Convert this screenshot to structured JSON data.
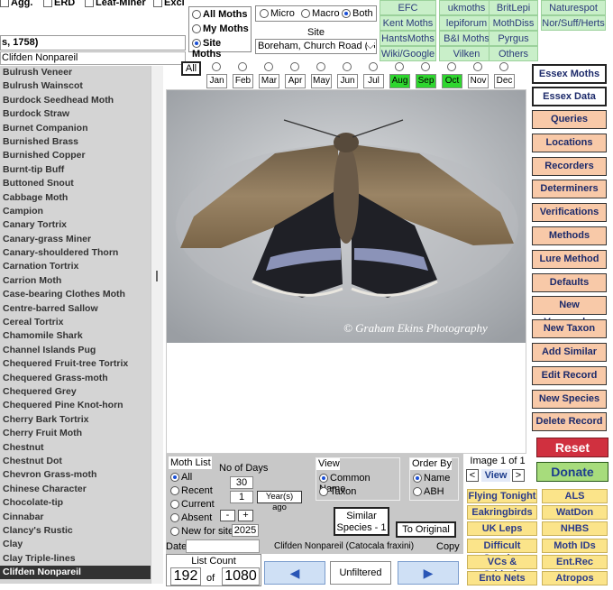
{
  "top_filters": {
    "agg": "Agg.",
    "erd": "ERD",
    "leaf_miner": "Leaf-Miner",
    "excl": "Excl"
  },
  "search_text": "s, 1758)",
  "selected_name_box": "Clifden Nonpareil",
  "species_list": [
    "Bulrush Veneer",
    "Bulrush Wainscot",
    "Burdock Seedhead Moth",
    "Burdock Straw",
    "Burnet Companion",
    "Burnished Brass",
    "Burnished Copper",
    "Burnt-tip Buff",
    "Buttoned Snout",
    "Cabbage Moth",
    "Campion",
    "Canary Tortrix",
    "Canary-grass Miner",
    "Canary-shouldered Thorn",
    "Carnation Tortrix",
    "Carrion Moth",
    "Case-bearing Clothes Moth",
    "Centre-barred Sallow",
    "Cereal Tortrix",
    "Chamomile Shark",
    "Channel Islands Pug",
    "Chequered Fruit-tree Tortrix",
    "Chequered Grass-moth",
    "Chequered Grey",
    "Chequered Pine Knot-horn",
    "Cherry Bark Tortrix",
    "Cherry Fruit Moth",
    "Chestnut",
    "Chestnut Dot",
    "Chevron Grass-moth",
    "Chinese Character",
    "Chocolate-tip",
    "Cinnabar",
    "Clancy's Rustic",
    "Clay",
    "Clay Triple-lines",
    "Clifden Nonpareil"
  ],
  "moth_scope": {
    "all": "All Moths",
    "my": "My Moths",
    "site": "Site Moths"
  },
  "size_filter": {
    "micro": "Micro",
    "macro": "Macro",
    "both": "Both"
  },
  "site": {
    "label": "Site",
    "value": "Boreham, Church Road (Ga"
  },
  "links": [
    "EFC",
    "ukmoths",
    "BritLepi",
    "Naturespot",
    "Kent Moths",
    "lepiforum",
    "MothDiss",
    "Nor/Suff/Herts",
    "HantsMoths",
    "B&I Moths",
    "Pyrgus",
    "Wiki/Google",
    "Vilken",
    "Others"
  ],
  "months": {
    "all": "All",
    "names": [
      "Jan",
      "Feb",
      "Mar",
      "Apr",
      "May",
      "Jun",
      "Jul",
      "Aug",
      "Sep",
      "Oct",
      "Nov",
      "Dec"
    ],
    "active": [
      "Aug",
      "Sep",
      "Oct"
    ]
  },
  "photo_credit": "© Graham Ekins Photography",
  "side_buttons": {
    "essex_moths": "Essex Moths",
    "essex_data": "Essex Data",
    "items": [
      "Queries",
      "Locations",
      "Recorders",
      "Determiners",
      "Verifications",
      "Methods",
      "Lure Method",
      "Defaults",
      "New Vernacular",
      "New Taxon",
      "Add Similar",
      "Edit Record",
      "New Species",
      "Delete Record"
    ],
    "reset": "Reset",
    "donate": "Donate"
  },
  "moth_list": {
    "title": "Moth List",
    "options": [
      "All",
      "Recent",
      "Current",
      "Absent",
      "New for site"
    ],
    "selected": "All"
  },
  "days": {
    "label": "No of Days",
    "days_value": "30",
    "years_value": "1",
    "years_label": "Year(s) ago",
    "minus": "-",
    "plus": "+",
    "year": "2025"
  },
  "view": {
    "title": "View",
    "common": "Common Name",
    "taxon": "Taxon"
  },
  "order_by": {
    "title": "Order By",
    "name": "Name",
    "abh": "ABH"
  },
  "similar_button": "Similar Species - 1",
  "to_original": "To Original",
  "image_nav": {
    "label": "Image 1 of 1",
    "prev": "<",
    "view": "View",
    "next": ">"
  },
  "date_bar": {
    "date_label": "Date",
    "species": "Clifden Nonpareil (Catocala fraxini)",
    "copy": "Copy"
  },
  "list_count": {
    "label": "List Count",
    "count": "192",
    "of": "of",
    "total": "1080",
    "filter": "Unfiltered"
  },
  "yellow_links": [
    "Flying Tonight",
    "ALS",
    "Eakringbirds",
    "WatDon",
    "UK Leps",
    "NHBS",
    "Difficult Species",
    "Moth IDs",
    "VCs & Gridrefs",
    "Ent.Rec",
    "Ento Nets",
    "Atropos"
  ]
}
